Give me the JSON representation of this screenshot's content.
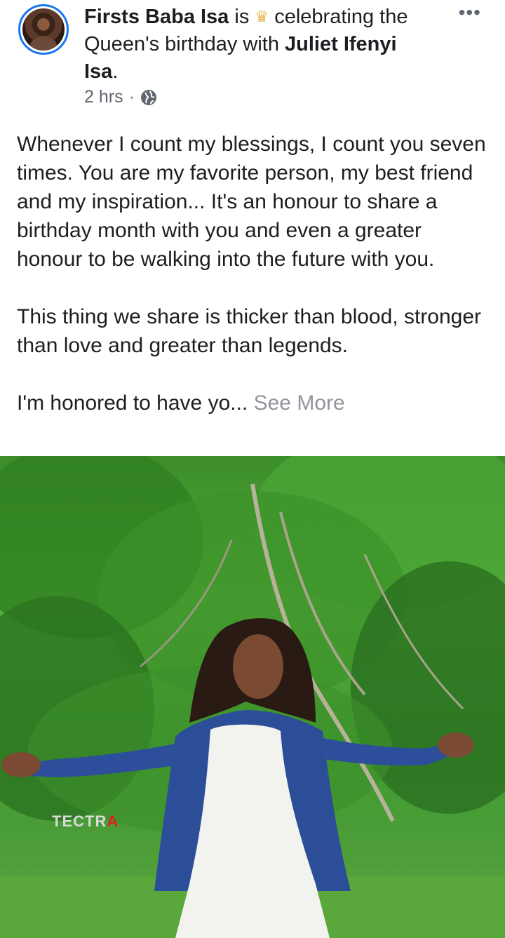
{
  "post": {
    "author": "Firsts Baba Isa",
    "verb": "is",
    "feeling": "celebrating the Queen's birthday with",
    "tagged": "Juliet Ifenyi Isa",
    "time": "2 hrs",
    "separator": "·",
    "paragraphs": [
      "Whenever I count my blessings, I count you seven times. You are my favorite person, my best friend and my inspiration... It's an honour to share a birthday month with you and even a greater honour to be walking into the future with you.",
      "This thing we share is thicker than blood, stronger than love and greater than legends."
    ],
    "truncated_text": "I'm honored to have yo...",
    "see_more": "See More",
    "more_options": "•••"
  },
  "photo": {
    "watermark": "TECTR",
    "watermark_accent": "A"
  },
  "icons": {
    "feeling": "crown-icon",
    "privacy": "globe-icon",
    "options": "more-dots-icon"
  },
  "colors": {
    "accent": "#1877f2",
    "text": "#1c1e21",
    "secondary": "#606770",
    "see_more": "#90949c"
  }
}
